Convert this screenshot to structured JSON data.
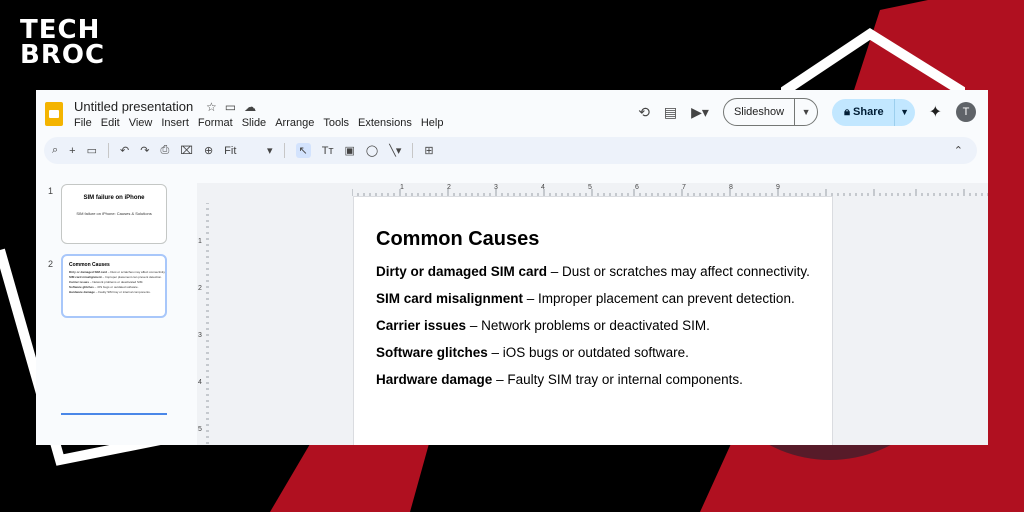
{
  "branding": {
    "logo_line1": "TECH",
    "logo_line2": "BROC"
  },
  "app": {
    "title": "Untitled presentation",
    "menu": [
      "File",
      "Edit",
      "View",
      "Insert",
      "Format",
      "Slide",
      "Arrange",
      "Tools",
      "Extensions",
      "Help"
    ],
    "slideshow_label": "Slideshow",
    "share_label": "Share",
    "avatar_letter": "T",
    "zoom_label": "Fit"
  },
  "filmstrip": {
    "slides": [
      {
        "number": "1",
        "title": "SIM failure on iPhone",
        "subtitle": "SIM failure on iPhone: Causes & Solutions"
      },
      {
        "number": "2",
        "title": "Common Causes",
        "lines": [
          {
            "bold": "Dirty or damaged SIM card",
            "rest": " – Dust or scratches may affect connectivity."
          },
          {
            "bold": "SIM card misalignment",
            "rest": " – Improper placement can prevent detection."
          },
          {
            "bold": "Carrier issues",
            "rest": " – Network problems or deactivated SIM."
          },
          {
            "bold": "Software glitches",
            "rest": " – iOS bugs or outdated software."
          },
          {
            "bold": "Hardware damage",
            "rest": " – Faulty SIM tray or internal components."
          }
        ]
      }
    ]
  },
  "rulers": {
    "h": [
      "1",
      "2",
      "3",
      "4",
      "5",
      "6",
      "7",
      "8",
      "9"
    ],
    "v": [
      "1",
      "2",
      "3",
      "4",
      "5"
    ]
  },
  "slide": {
    "title": "Common Causes",
    "bullets": [
      {
        "bold": "Dirty or damaged SIM card",
        "rest": " – Dust or scratches may affect connectivity."
      },
      {
        "bold": "SIM card misalignment",
        "rest": " – Improper placement can prevent detection."
      },
      {
        "bold": "Carrier issues",
        "rest": " – Network problems or deactivated SIM."
      },
      {
        "bold": "Software glitches",
        "rest": " – iOS bugs or outdated software."
      },
      {
        "bold": "Hardware damage",
        "rest": " – Faulty SIM tray or internal components."
      }
    ]
  },
  "colors": {
    "brand_red": "#c8102e",
    "accent_blue": "#c2e7ff",
    "doc_yellow": "#f4b400"
  },
  "icons": [
    "star-icon",
    "move-folder-icon",
    "cloud-status-icon",
    "history-icon",
    "comment-icon",
    "video-call-icon",
    "lock-icon",
    "gemini-icon",
    "search-icon",
    "plus-icon",
    "layout-icon",
    "undo-icon",
    "redo-icon",
    "print-icon",
    "paint-format-icon",
    "zoom-icon",
    "select-icon",
    "textbox-icon",
    "image-icon",
    "shape-icon",
    "line-icon",
    "add-comment-icon",
    "collapse-icon"
  ]
}
